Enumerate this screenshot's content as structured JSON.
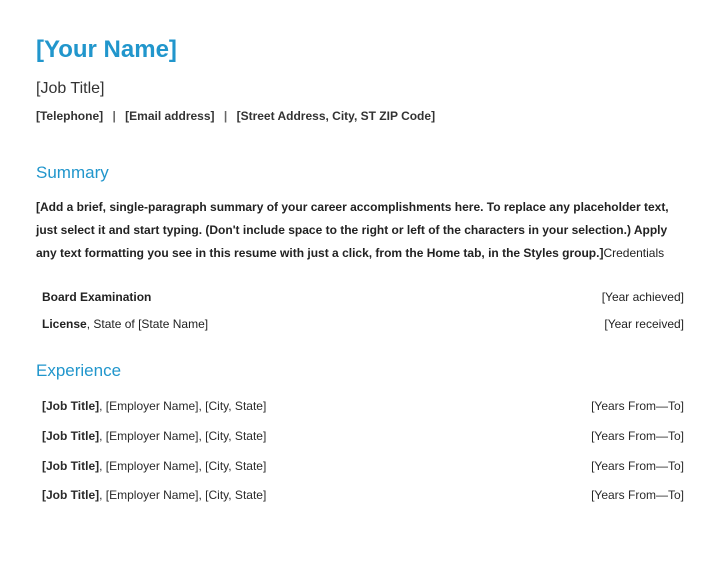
{
  "header": {
    "name": "[Your Name]",
    "job_title": "[Job Title]",
    "telephone": "[Telephone]",
    "email": "[Email address]",
    "address": "[Street Address, City, ST ZIP Code]"
  },
  "summary": {
    "title": "Summary",
    "body": "[Add a brief, single-paragraph summary of your career accomplishments here. To replace any placeholder text, just select it and start typing. (Don't include space to the right or left of the characters in your selection.) Apply any text formatting you see in this resume with just a click, from the Home tab, in the Styles group.]",
    "trailing": "Credentials"
  },
  "credentials": [
    {
      "label_bold": "Board Examination",
      "label_rest": "",
      "right": "[Year achieved]"
    },
    {
      "label_bold": "License",
      "label_rest": ", State of [State Name]",
      "right": "[Year received]"
    }
  ],
  "experience": {
    "title": "Experience",
    "items": [
      {
        "title": "[Job Title]",
        "rest": ", [Employer Name], [City, State]",
        "right": "[Years From—To]"
      },
      {
        "title": "[Job Title]",
        "rest": ", [Employer Name], [City, State]",
        "right": "[Years From—To]"
      },
      {
        "title": "[Job Title]",
        "rest": ", [Employer Name], [City, State]",
        "right": "[Years From—To]"
      },
      {
        "title": "[Job Title]",
        "rest": ", [Employer Name], [City, State]",
        "right": "[Years From—To]"
      }
    ]
  }
}
